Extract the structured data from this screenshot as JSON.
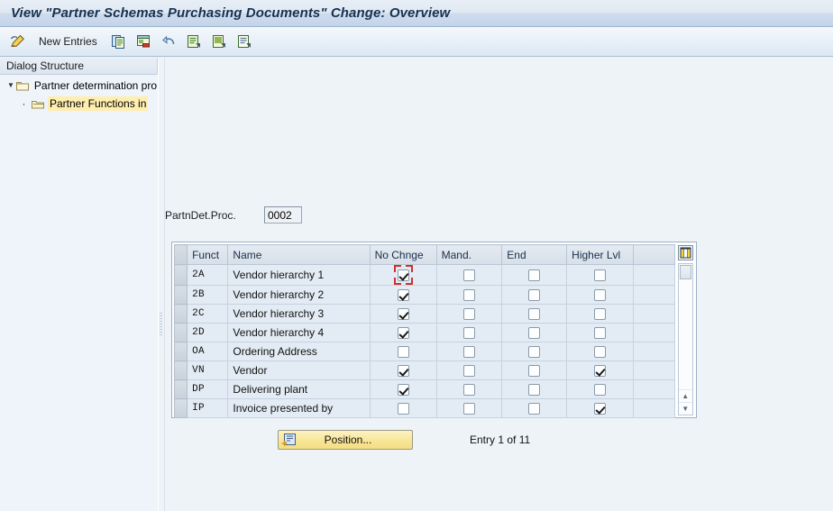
{
  "window": {
    "title": "View \"Partner Schemas Purchasing Documents\" Change: Overview"
  },
  "toolbar": {
    "display_change_icon": "pencil-toggle-icon",
    "new_entries_label": "New Entries",
    "copy_icon": "copy-as-icon",
    "delete_icon": "delete-row-icon",
    "undo_icon": "undo-icon",
    "prev_entry_icon": "previous-entry-icon",
    "next_entry_icon": "next-entry-icon",
    "details_icon": "details-icon"
  },
  "sidebar": {
    "header": "Dialog Structure",
    "items": [
      {
        "label": "Partner determination pro",
        "level": 0,
        "expanded": true,
        "selected": false,
        "icon": "folder-icon"
      },
      {
        "label": "Partner Functions in",
        "level": 1,
        "expanded": false,
        "selected": true,
        "icon": "folder-open-icon"
      }
    ]
  },
  "main": {
    "field": {
      "label": "PartnDet.Proc.",
      "value": "0002"
    },
    "grid_config_icon": "table-settings-icon",
    "table": {
      "columns": [
        "Funct",
        "Name",
        "No Chnge",
        "Mand.",
        "End",
        "Higher Lvl"
      ],
      "rows": [
        {
          "funct": "2A",
          "name": "Vendor hierarchy 1",
          "no_chnge": true,
          "mand": false,
          "end": false,
          "higher_lvl": false,
          "focused": true
        },
        {
          "funct": "2B",
          "name": "Vendor hierarchy 2",
          "no_chnge": true,
          "mand": false,
          "end": false,
          "higher_lvl": false,
          "focused": false
        },
        {
          "funct": "2C",
          "name": "Vendor hierarchy 3",
          "no_chnge": true,
          "mand": false,
          "end": false,
          "higher_lvl": false,
          "focused": false
        },
        {
          "funct": "2D",
          "name": "Vendor hierarchy 4",
          "no_chnge": true,
          "mand": false,
          "end": false,
          "higher_lvl": false,
          "focused": false
        },
        {
          "funct": "OA",
          "name": "Ordering Address",
          "no_chnge": false,
          "mand": false,
          "end": false,
          "higher_lvl": false,
          "focused": false
        },
        {
          "funct": "VN",
          "name": "Vendor",
          "no_chnge": true,
          "mand": false,
          "end": false,
          "higher_lvl": true,
          "focused": false
        },
        {
          "funct": "DP",
          "name": "Delivering plant",
          "no_chnge": true,
          "mand": false,
          "end": false,
          "higher_lvl": false,
          "focused": false
        },
        {
          "funct": "IP",
          "name": "Invoice presented by",
          "no_chnge": false,
          "mand": false,
          "end": false,
          "higher_lvl": true,
          "focused": false
        }
      ]
    },
    "position_button": {
      "label": "Position...",
      "icon": "position-icon"
    },
    "entry_status": "Entry 1 of 11"
  },
  "colors": {
    "title_text": "#17314f",
    "selection_highlight": "#ffeeb0",
    "focus_marker": "#d0302f",
    "button_yellow": "#f8e79a"
  }
}
